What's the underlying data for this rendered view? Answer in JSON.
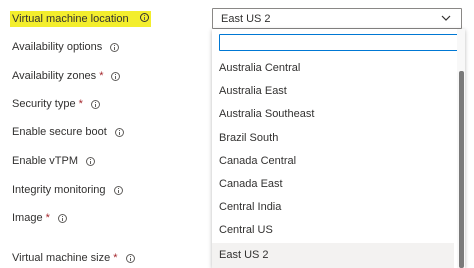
{
  "form": {
    "fields": [
      {
        "label": "Virtual machine location",
        "required": false,
        "highlighted": true,
        "info_icon": "info-icon"
      },
      {
        "label": "Availability options",
        "required": false,
        "info_icon": "info-icon"
      },
      {
        "label": "Availability zones",
        "required": true,
        "info_icon": "info-icon"
      },
      {
        "label": "Security type",
        "required": true,
        "info_icon": "info-icon"
      },
      {
        "label": "Enable secure boot",
        "required": false,
        "info_icon": "info-icon"
      },
      {
        "label": "Enable vTPM",
        "required": false,
        "info_icon": "info-icon"
      },
      {
        "label": "Integrity monitoring",
        "required": false,
        "info_icon": "info-icon"
      },
      {
        "label": "Image",
        "required": true,
        "info_icon": "info-icon"
      },
      {
        "label": "Virtual machine size",
        "required": true,
        "info_icon": "info-icon"
      }
    ],
    "required_marker": "*"
  },
  "location_dropdown": {
    "selected_value": "East US 2",
    "chevron_icon": "chevron-down-icon",
    "filter_value": "",
    "options": [
      "Australia Central",
      "Australia East",
      "Australia Southeast",
      "Brazil South",
      "Canada Central",
      "Canada East",
      "Central India",
      "Central US",
      "East US 2"
    ],
    "highlighted_option": "East US 2"
  },
  "colors": {
    "highlight": "#f3ee2d",
    "focus_border": "#0078d4",
    "required": "#a4262c",
    "selected_option_bg": "#f3f2f1"
  }
}
